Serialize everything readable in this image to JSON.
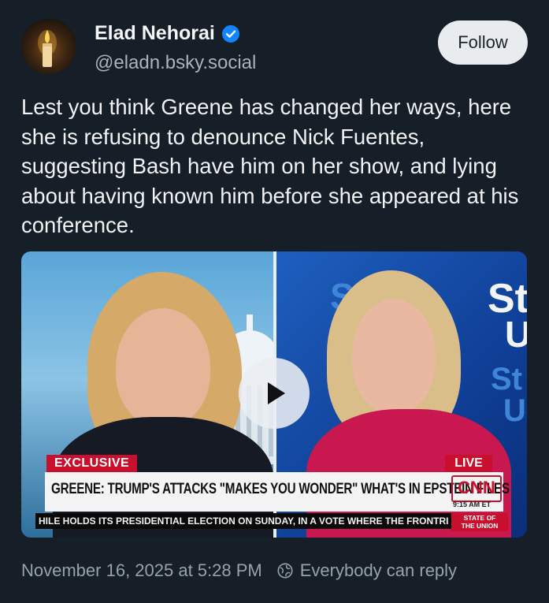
{
  "author": {
    "display_name": "Elad Nehorai",
    "handle": "@eladn.bsky.social",
    "verified": true,
    "avatar_icon": "candle-avatar"
  },
  "follow_button": {
    "label": "Follow"
  },
  "post": {
    "text": "Lest you think Greene has changed her ways, here she is refusing to denounce Nick Fuentes, suggesting Bash have him on her show, and lying about having known him before she appeared at his conference."
  },
  "video": {
    "play_icon": "play-icon",
    "chyron": {
      "tag_left": "EXCLUSIVE",
      "tag_right": "LIVE",
      "headline": "GREENE: TRUMP'S ATTACKS \"MAKES YOU WONDER\" WHAT'S IN EPSTEIN FILES",
      "network_logo": "CNN",
      "time": "9:15 AM ET",
      "ticker": "HILE HOLDS ITS PRESIDENTIAL ELECTION ON SUNDAY, IN A VOTE WHERE THE FRONTRI",
      "show_line1": "STATE OF",
      "show_line2": "THE UNION"
    },
    "set_text": "St",
    "set_text_u": "U"
  },
  "meta": {
    "timestamp": "November 16, 2025 at 5:28 PM",
    "reply_setting": "Everybody can reply"
  },
  "colors": {
    "background": "#161e27",
    "verified_badge": "#1185fe",
    "cnn_red": "#c8102e"
  }
}
